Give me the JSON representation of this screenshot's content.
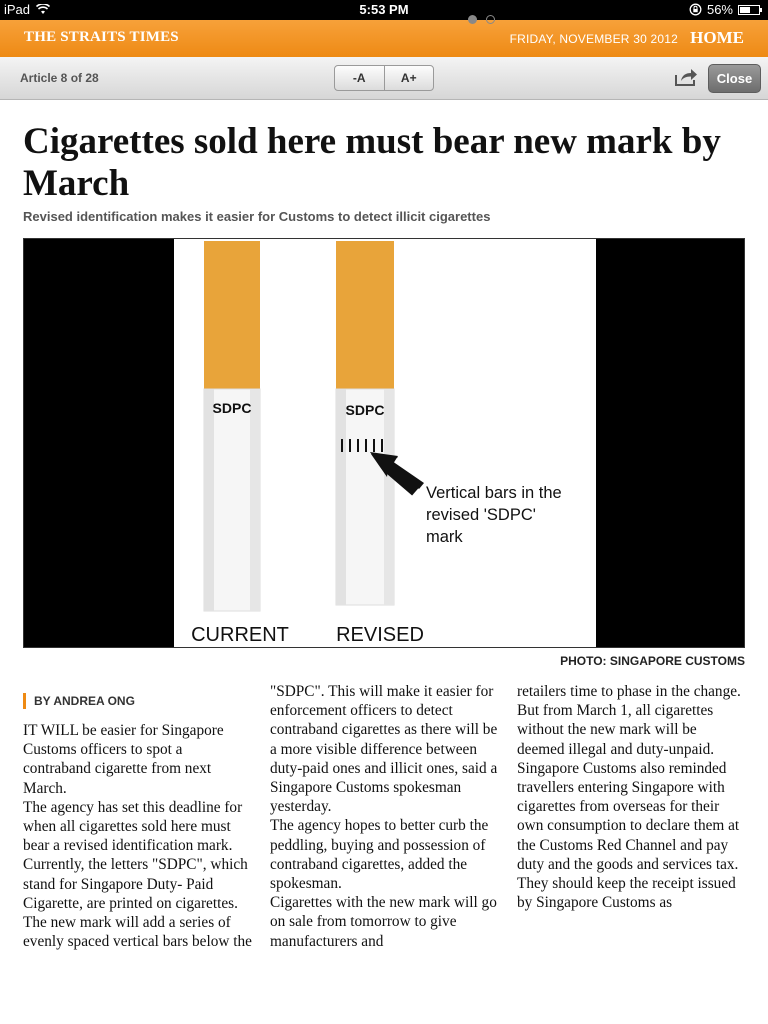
{
  "status_bar": {
    "device": "iPad",
    "time": "5:53 PM",
    "battery": "56%",
    "battery_level": 0.56
  },
  "masthead": {
    "brand": "THE STRAITS TIMES",
    "date": "FRIDAY, NOVEMBER 30 2012",
    "home": "HOME"
  },
  "toolbar": {
    "article_count": "Article 8 of 28",
    "font_smaller": "-A",
    "font_larger": "A+",
    "close": "Close",
    "page_indicator": {
      "pages": 2,
      "current": 1
    }
  },
  "article": {
    "headline": "Cigarettes sold here must bear new mark by March",
    "subhead": "Revised identification makes it easier for Customs to detect illicit cigarettes",
    "photo": {
      "label_current": "CURRENT",
      "label_revised": "REVISED",
      "mark_left": "SDPC",
      "mark_right": "SDPC",
      "annotation": [
        "Vertical bars in the",
        "revised 'SDPC'",
        "mark"
      ]
    },
    "photo_credit": "PHOTO: SINGAPORE CUSTOMS",
    "byline": "BY ANDREA ONG",
    "column1": [
      "IT WILL be easier for Singapore Customs officers to spot a contraband cigarette from next March.",
      " The agency has set this deadline for when all cigarettes sold here must bear a revised identification mark.",
      " Currently, the letters \"SDPC\", which stand for Singapore Duty- Paid Cigarette, are printed on cigarettes. The new mark will add a series of evenly spaced vertical bars below the"
    ],
    "column2": [
      "\"SDPC\". This will make it easier for enforcement officers to detect contraband cigarettes as there will be a more visible difference between duty-paid ones and illicit ones, said a Singapore Customs spokesman yesterday.",
      " The agency hopes to better curb the peddling, buying and possession of contraband cigarettes, added the spokesman.",
      " Cigarettes with the new mark will go on sale from tomorrow to give manufacturers and"
    ],
    "column3": [
      "retailers time to phase in the change.",
      " But from March 1, all cigarettes without the new mark will be deemed illegal and duty-unpaid.",
      " Singapore Customs also reminded travellers entering Singapore with cigarettes from overseas for their own consumption to declare them at the Customs Red Channel and pay duty and the goods and services tax.",
      " They should keep the receipt issued by Singapore Customs as"
    ]
  },
  "colors": {
    "accent": "#ee8a14",
    "filter": "#e8a43a"
  }
}
